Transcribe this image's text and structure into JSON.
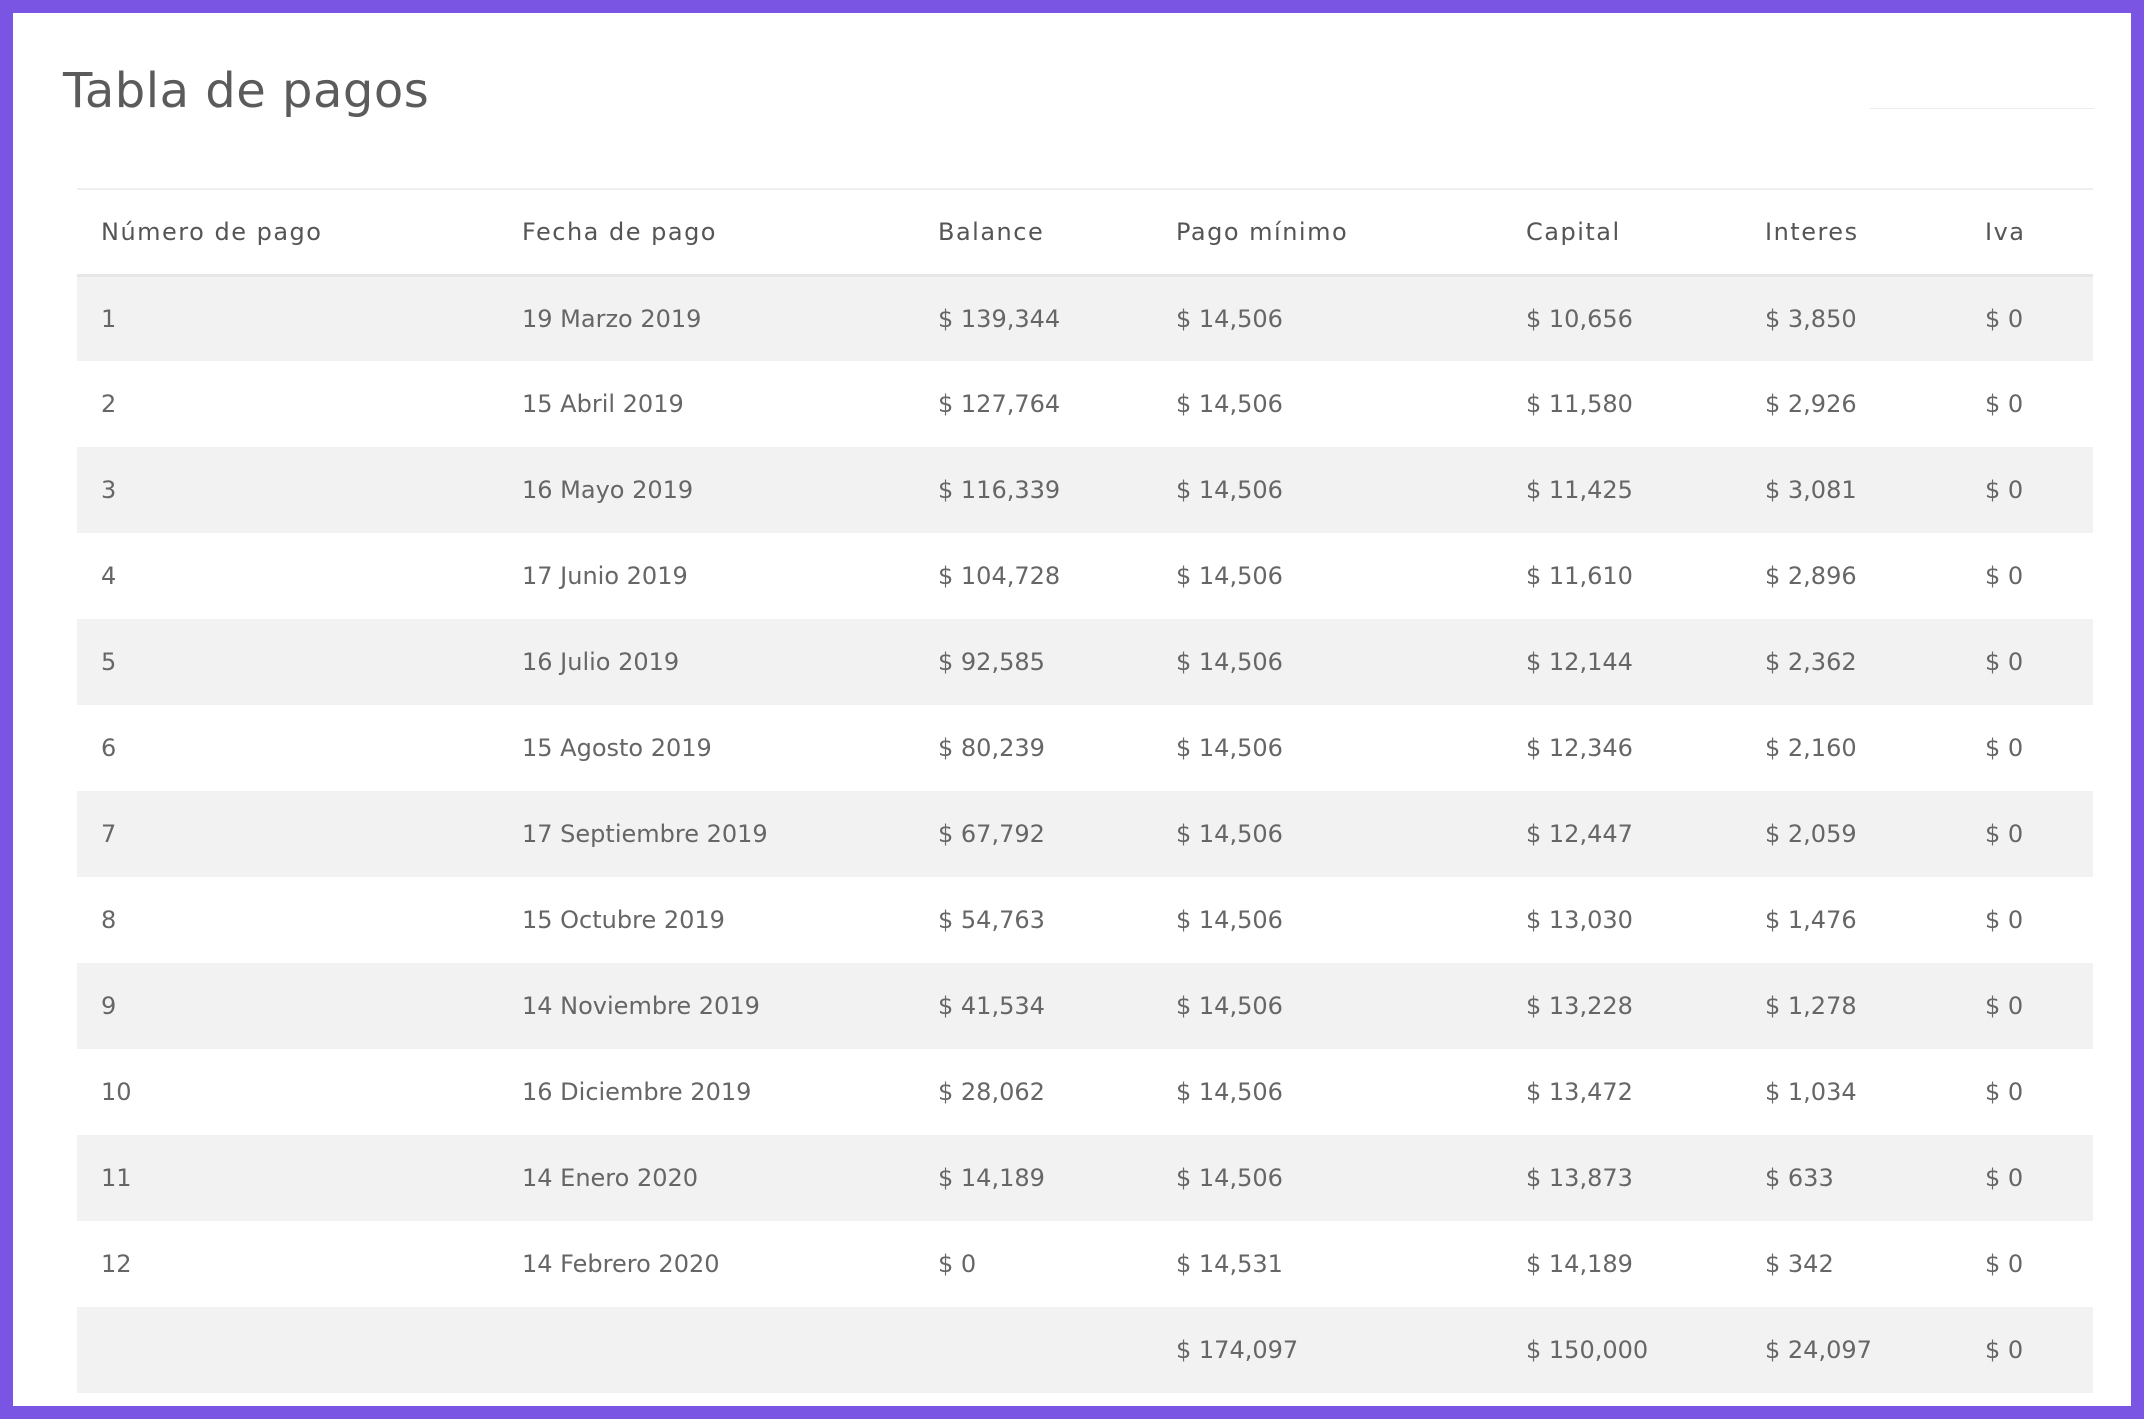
{
  "page": {
    "title": "Tabla de pagos"
  },
  "colors": {
    "frame_border": "#7a55e3",
    "row_stripe": "#f2f2f2",
    "text": "#666666"
  },
  "table": {
    "headers": [
      "Número de pago",
      "Fecha de pago",
      "Balance",
      "Pago mínimo",
      "Capital",
      "Interes",
      "Iva"
    ],
    "rows": [
      [
        "1",
        "19 Marzo 2019",
        "$ 139,344",
        "$ 14,506",
        "$ 10,656",
        "$ 3,850",
        "$ 0"
      ],
      [
        "2",
        "15 Abril 2019",
        "$ 127,764",
        "$ 14,506",
        "$ 11,580",
        "$ 2,926",
        "$ 0"
      ],
      [
        "3",
        "16 Mayo 2019",
        "$ 116,339",
        "$ 14,506",
        "$ 11,425",
        "$ 3,081",
        "$ 0"
      ],
      [
        "4",
        "17 Junio 2019",
        "$ 104,728",
        "$ 14,506",
        "$ 11,610",
        "$ 2,896",
        "$ 0"
      ],
      [
        "5",
        "16 Julio 2019",
        "$ 92,585",
        "$ 14,506",
        "$ 12,144",
        "$ 2,362",
        "$ 0"
      ],
      [
        "6",
        "15 Agosto 2019",
        "$ 80,239",
        "$ 14,506",
        "$ 12,346",
        "$ 2,160",
        "$ 0"
      ],
      [
        "7",
        "17 Septiembre 2019",
        "$ 67,792",
        "$ 14,506",
        "$ 12,447",
        "$ 2,059",
        "$ 0"
      ],
      [
        "8",
        "15 Octubre 2019",
        "$ 54,763",
        "$ 14,506",
        "$ 13,030",
        "$ 1,476",
        "$ 0"
      ],
      [
        "9",
        "14 Noviembre 2019",
        "$ 41,534",
        "$ 14,506",
        "$ 13,228",
        "$ 1,278",
        "$ 0"
      ],
      [
        "10",
        "16 Diciembre 2019",
        "$ 28,062",
        "$ 14,506",
        "$ 13,472",
        "$ 1,034",
        "$ 0"
      ],
      [
        "11",
        "14 Enero 2020",
        "$ 14,189",
        "$ 14,506",
        "$ 13,873",
        "$ 633",
        "$ 0"
      ],
      [
        "12",
        "14 Febrero 2020",
        "$ 0",
        "$ 14,531",
        "$ 14,189",
        "$ 342",
        "$ 0"
      ],
      [
        "",
        "",
        "",
        "$ 174,097",
        "$ 150,000",
        "$ 24,097",
        "$ 0"
      ]
    ]
  }
}
